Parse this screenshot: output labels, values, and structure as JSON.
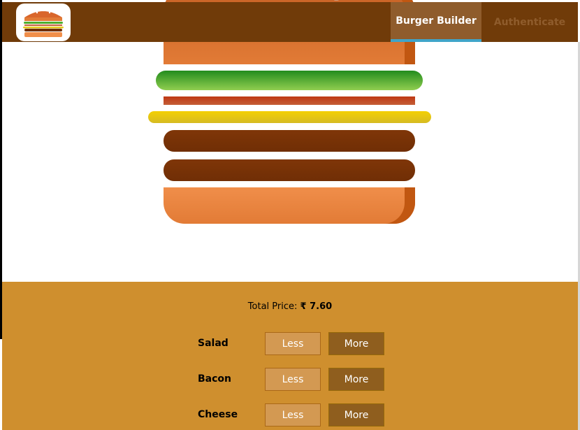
{
  "toolbar": {
    "logo_icon": "burger-logo",
    "nav": [
      {
        "label": "Burger Builder",
        "active": true
      },
      {
        "label": "Authenticate",
        "active": false
      }
    ]
  },
  "burger": {
    "ingredients": [
      "salad",
      "bacon",
      "cheese",
      "meat",
      "meat"
    ]
  },
  "build_controls": {
    "price_label": "Total Price:",
    "price_value": "₹ 7.60",
    "controls": [
      {
        "label": "Salad",
        "less_label": "Less",
        "more_label": "More"
      },
      {
        "label": "Bacon",
        "less_label": "Less",
        "more_label": "More"
      },
      {
        "label": "Cheese",
        "less_label": "Less",
        "more_label": "More"
      }
    ]
  },
  "colors": {
    "toolbar_bg": "#703b09",
    "nav_active_bg": "#8f5c2c",
    "nav_active_underline": "#40a4c8",
    "controls_bg": "#cf8f2e",
    "less_button_bg": "#d39952",
    "more_button_bg": "#8f5e1e"
  }
}
